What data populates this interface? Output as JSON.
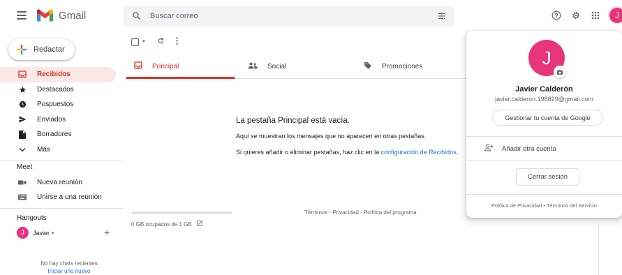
{
  "header": {
    "app_name": "Gmail",
    "search_placeholder": "Buscar correo",
    "avatar_initial": "J"
  },
  "sidebar": {
    "compose_label": "Redactar",
    "items": [
      {
        "label": "Recibidos",
        "icon": "inbox-icon",
        "active": true
      },
      {
        "label": "Destacados",
        "icon": "star-icon"
      },
      {
        "label": "Pospuestos",
        "icon": "clock-icon"
      },
      {
        "label": "Enviados",
        "icon": "send-icon"
      },
      {
        "label": "Borradores",
        "icon": "draft-icon"
      },
      {
        "label": "Más",
        "icon": "chevron-down-icon"
      }
    ],
    "meet": {
      "title": "Meet",
      "new_meeting": "Nueva reunión",
      "join_meeting": "Unirse a una reunión"
    },
    "hangouts": {
      "title": "Hangouts",
      "user_initial": "J",
      "user_name": "Javier",
      "no_chats": "No hay chats recientes",
      "start_new": "Iniciar uno nuevo"
    }
  },
  "tabs": [
    {
      "label": "Principal",
      "icon": "inbox-icon",
      "active": true
    },
    {
      "label": "Social",
      "icon": "people-icon"
    },
    {
      "label": "Promociones",
      "icon": "tag-icon"
    }
  ],
  "empty": {
    "title": "La pestaña Principal está vacía.",
    "line1": "Aquí se muestran los mensajes que no aparecen en otras pestañas.",
    "line2_prefix": "Si quieres añadir o eliminar pestañas, haz clic en la ",
    "line2_link": "configuración de Recibidos",
    "line2_suffix": "."
  },
  "footer": {
    "storage_text": "0 GB ocupados de 1 GB",
    "storage_fraction": 0,
    "terms": "Términos",
    "privacy": "Privacidad",
    "policy": "Política del programa",
    "separator": " · "
  },
  "account": {
    "initial": "J",
    "name": "Javier Calderón",
    "email": "javier.calderon.198829@gmail.com",
    "manage": "Gestionar tu cuenta de Google",
    "add_account": "Añadir otra cuenta",
    "sign_out": "Cerrar sesión",
    "privacy_policy": "Política de Privacidad",
    "terms": "Términos del Servicio",
    "bullet": " • "
  },
  "colors": {
    "accent_red": "#d93025",
    "avatar_pink": "#e8347a",
    "link_blue": "#1a73e8"
  }
}
